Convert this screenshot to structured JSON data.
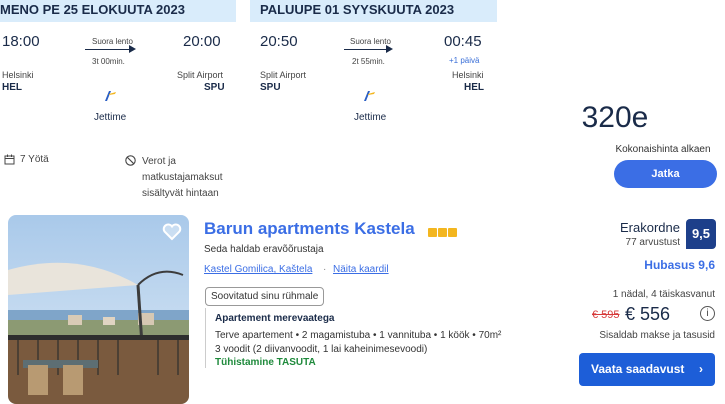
{
  "outbound": {
    "header": "MENO PE 25 ELOKUUTA 2023",
    "depart_time": "18:00",
    "arrive_time": "20:00",
    "flight_type": "Suora lento",
    "duration": "3t 00min.",
    "from_city": "Helsinki",
    "from_code": "HEL",
    "to_city": "Split Airport",
    "to_code": "SPU",
    "airline": "Jettime"
  },
  "return": {
    "header": "PALUUPE 01 SYYSKUUTA 2023",
    "depart_time": "20:50",
    "arrive_time": "00:45",
    "flight_type": "Suora lento",
    "duration": "2t 55min.",
    "plus_day": "+1 päivä",
    "from_city": "Split Airport",
    "from_code": "SPU",
    "to_city": "Helsinki",
    "to_code": "HEL",
    "airline": "Jettime"
  },
  "trip_meta": {
    "nights": "7 Yötä",
    "taxes_line1": "Verot ja",
    "taxes_line2": "matkustajamaksut",
    "taxes_line3": "sisältyvät hintaan"
  },
  "package_price": {
    "amount": "320e",
    "label": "Kokonaishinta alkaen",
    "button": "Jatka"
  },
  "hotel": {
    "name": "Barun apartments Kastela",
    "star_count": 3,
    "operator": "Seda haldab eravõõrustaja",
    "location": "Kastel Gomilica, Kaštela",
    "location_sep": "·",
    "map_link": "Näita kaardil",
    "recommended_tag": "Soovitatud sinu rühmale",
    "room_title": "Apartement merevaatega",
    "room_desc": "Terve apartement • 2 magamistuba • 1 vannituba • 1 köök • 70m²",
    "room_beds": "3 voodit (2 diivanvoodit, 1 lai kaheinimesevoodi)",
    "cancellation": "Tühistamine TASUTA",
    "rating_word": "Erakordne",
    "rating_count": "77 arvustust",
    "rating_score": "9,5",
    "location_score": "Hubasus 9,6",
    "stay_duration": "1 nädal, 4 täiskasvanut",
    "old_price": "€ 595",
    "new_price": "€ 556",
    "price_note": "Sisaldab makse ja tasusid",
    "availability_button": "Vaata saadavust",
    "availability_chevron": "›"
  },
  "colors": {
    "accent": "#3b6ee5",
    "header_bg": "#d9ecfb",
    "rating_badge": "#1d3f8a",
    "free_cancel": "#1f8a3c",
    "old_price": "#d63838",
    "star": "#f3b61f"
  },
  "icons": [
    "calendar-icon",
    "no-tax-icon",
    "airline-logo-icon",
    "heart-icon",
    "star-icon",
    "info-icon",
    "chevron-right-icon"
  ]
}
